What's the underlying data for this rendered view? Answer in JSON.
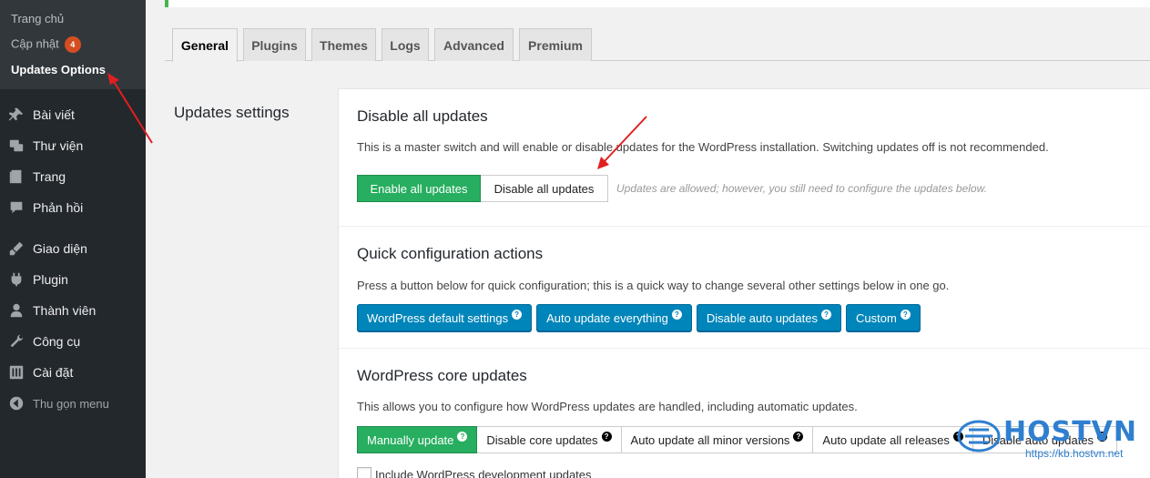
{
  "sidebar": {
    "submenu": {
      "home": "Trang chủ",
      "updates": "Cập nhật",
      "updates_badge": "4",
      "options": "Updates Options"
    },
    "items": [
      {
        "label": "Bài viết",
        "icon": "pin-icon"
      },
      {
        "label": "Thư viện",
        "icon": "media-icon"
      },
      {
        "label": "Trang",
        "icon": "page-icon"
      },
      {
        "label": "Phản hồi",
        "icon": "comments-icon"
      },
      {
        "label": "Giao diện",
        "icon": "appearance-icon"
      },
      {
        "label": "Plugin",
        "icon": "plugin-icon"
      },
      {
        "label": "Thành viên",
        "icon": "users-icon"
      },
      {
        "label": "Công cụ",
        "icon": "tools-icon"
      },
      {
        "label": "Cài đặt",
        "icon": "settings-icon"
      }
    ],
    "collapse": "Thu gọn menu"
  },
  "tabs": [
    "General",
    "Plugins",
    "Themes",
    "Logs",
    "Advanced",
    "Premium"
  ],
  "section_title": "Updates settings",
  "disable_all": {
    "heading": "Disable all updates",
    "description": "This is a master switch and will enable or disable updates for the WordPress installation. Switching updates off is not recommended.",
    "enable_label": "Enable all updates",
    "disable_label": "Disable all updates",
    "hint": "Updates are allowed; however, you still need to configure the updates below."
  },
  "quick": {
    "heading": "Quick configuration actions",
    "description": "Press a button below for quick configuration; this is a quick way to change several other settings below in one go.",
    "buttons": [
      "WordPress default settings",
      "Auto update everything",
      "Disable auto updates",
      "Custom"
    ]
  },
  "core": {
    "heading": "WordPress core updates",
    "description": "This allows you to configure how WordPress updates are handled, including automatic updates.",
    "buttons": [
      "Manually update",
      "Disable core updates",
      "Auto update all minor versions",
      "Auto update all releases",
      "Disable auto updates"
    ],
    "checkbox_label": "Include WordPress development updates"
  },
  "help_glyph": "?",
  "watermark": {
    "brand": "HOSTVN",
    "url": "https://kb.hostvn.net"
  },
  "colors": {
    "sidebar_bg": "#23282d",
    "accent_green": "#27ae60",
    "accent_blue": "#0085ba",
    "badge": "#d54e21",
    "arrow": "#e02020"
  }
}
